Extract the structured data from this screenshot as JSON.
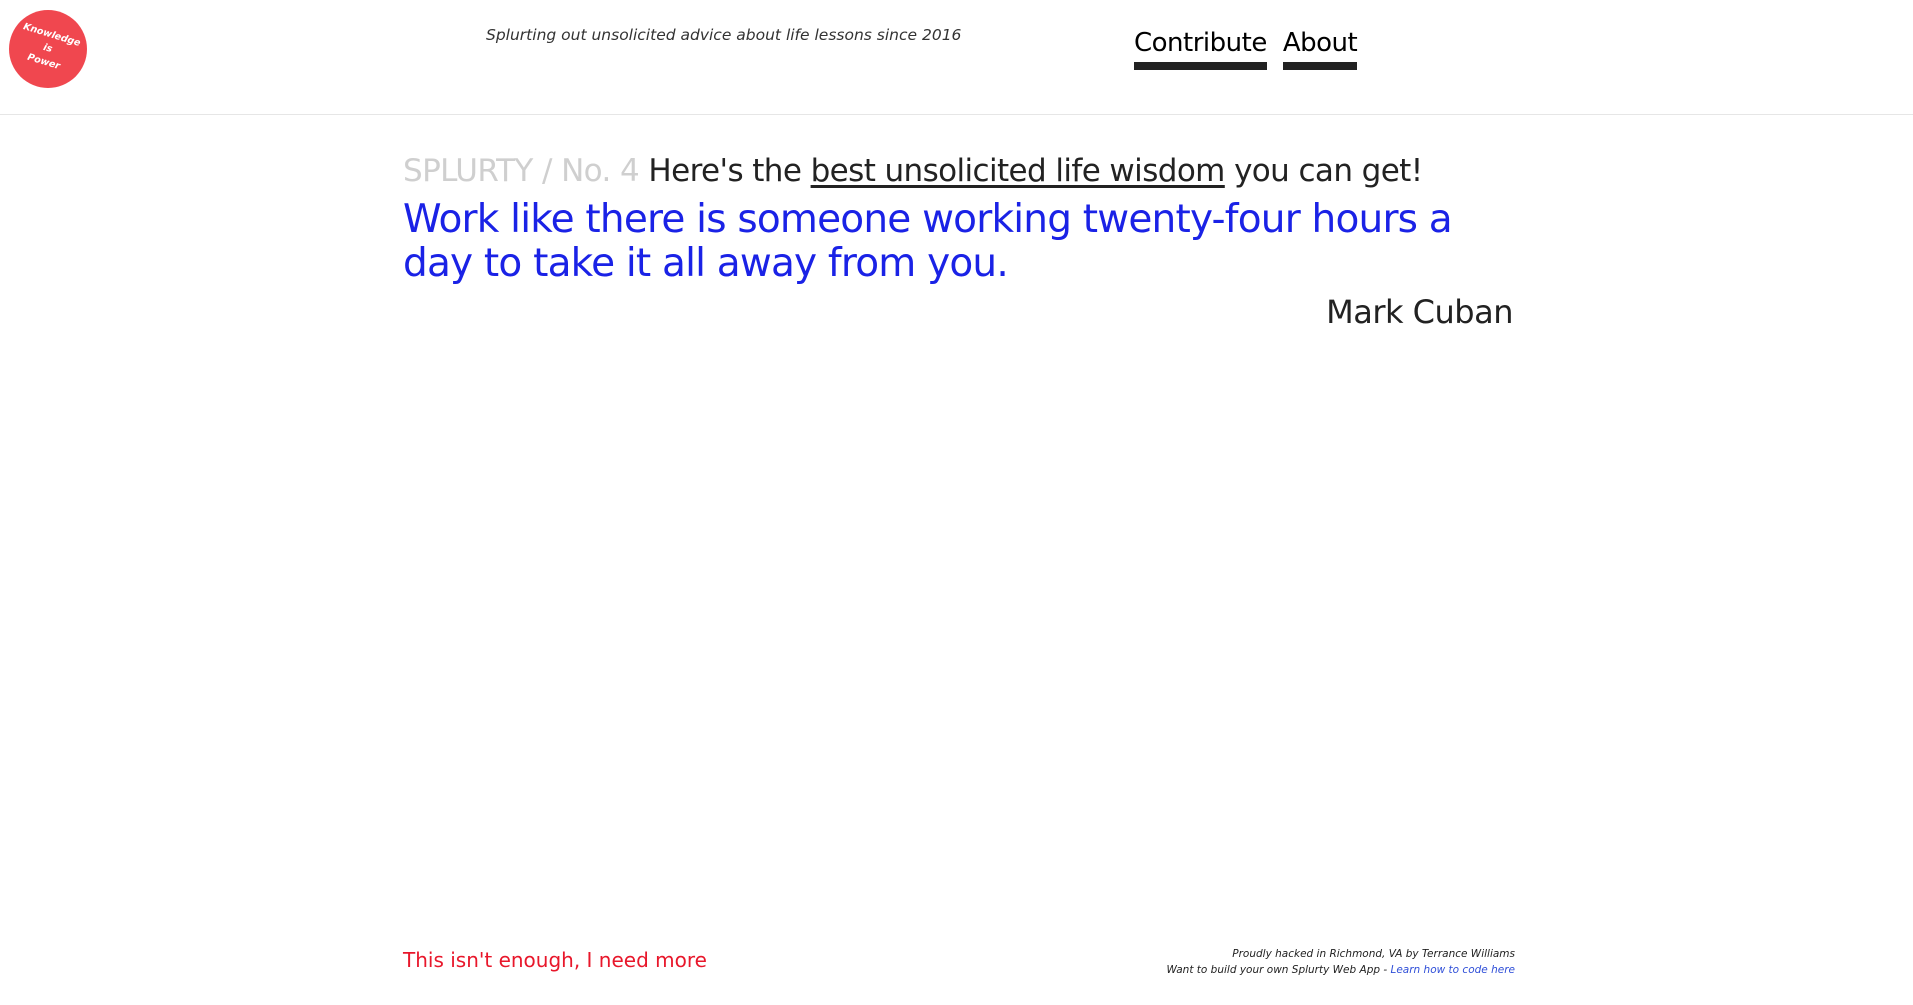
{
  "header": {
    "logo": {
      "line1": "Knowledge",
      "line2": "is",
      "line3": "Power",
      "color": "#f0474f"
    },
    "tagline": "Splurting out unsolicited advice about life lessons since 2016",
    "nav": {
      "contribute": "Contribute",
      "about": "About"
    }
  },
  "main": {
    "brand": "SPLURTY / No. 4",
    "lead_before": "Here's the",
    "lead_link": "best unsolicited life wisdom",
    "lead_after": "you can get!",
    "quote": "Work like there is someone working twenty-four hours a day to take it all away from you.",
    "author": "Mark Cuban",
    "quote_color": "#1a22e6"
  },
  "footer": {
    "more_link": "This isn't enough, I need more",
    "credit_line1": "Proudly hacked in Richmond, VA by Terrance Williams",
    "credit_line2_prefix": "Want to build your own Splurty Web App -",
    "credit_link": "Learn how to code here",
    "more_color": "#e8172b"
  }
}
